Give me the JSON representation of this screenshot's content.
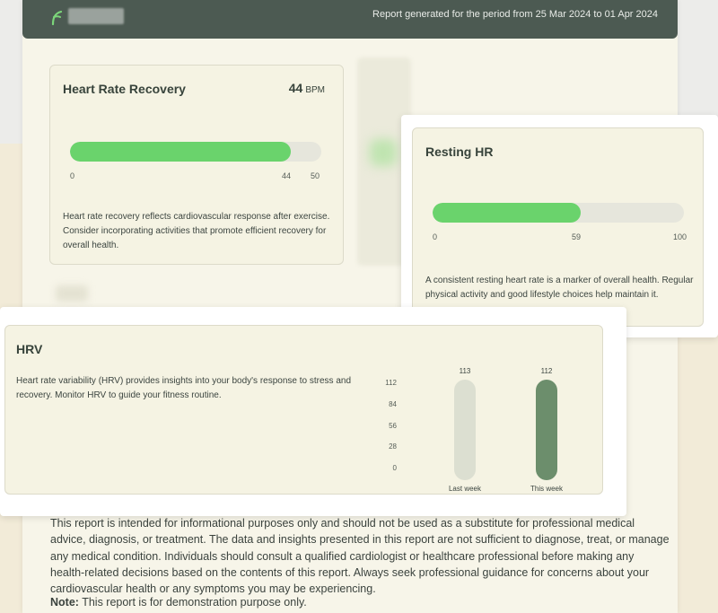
{
  "header": {
    "logo_icon": "leaf-icon",
    "report_period": "Report generated for the period from 25 Mar 2024 to 01 Apr 2024"
  },
  "heart_rate_recovery": {
    "title": "Heart Rate Recovery",
    "value": "44",
    "unit": "BPM",
    "bar": {
      "value": 44,
      "max": 50
    },
    "ticks": {
      "min": "0",
      "current": "44",
      "max": "50"
    },
    "description": "Heart rate recovery reflects cardiovascular response after exercise. Consider incorporating activities that promote efficient recovery for overall health."
  },
  "resting_hr": {
    "title": "Resting HR",
    "bar": {
      "value": 59,
      "max": 100
    },
    "ticks": {
      "min": "0",
      "current": "59",
      "max": "100"
    },
    "description": "A consistent resting heart rate is a marker of overall health. Regular physical activity and good lifestyle choices help maintain it."
  },
  "hrv": {
    "title": "HRV",
    "description": "Heart rate variability (HRV) provides insights into your body's response to stress and recovery. Monitor HRV to guide your fitness routine.",
    "chart_data": {
      "type": "bar",
      "categories": [
        "Last week",
        "This week"
      ],
      "values": [
        113,
        112
      ],
      "value_labels": [
        "113",
        "112"
      ],
      "yticks": [
        "112",
        "84",
        "56",
        "28",
        "0"
      ],
      "ylim": [
        0,
        112
      ],
      "colors": [
        "#dcdfd1",
        "#6c8e6c"
      ]
    }
  },
  "disclaimer": {
    "text": "This report is intended for informational purposes only and should not be used as a substitute for professional medical advice, diagnosis, or treatment. The data and insights presented in this report are not sufficient to diagnose, treat, or manage any medical condition. Individuals should consult a qualified cardiologist or healthcare professional before making any health-related decisions based on the contents of this report. Always seek professional guidance for concerns about your cardiovascular health or any symptoms you may be experiencing.",
    "note_label": "Note:",
    "note_text": " This report is for demonstration purpose only."
  },
  "colors": {
    "header_bg": "#4c5a52",
    "progress_fill": "#6ad36c",
    "hrv_this_week": "#6c8e6c",
    "hrv_last_week": "#dcdfd1"
  }
}
